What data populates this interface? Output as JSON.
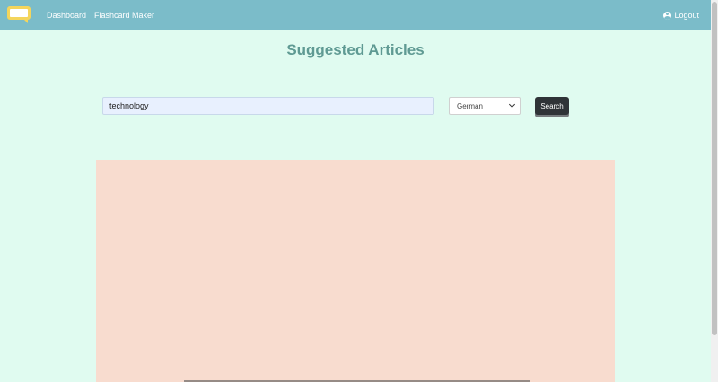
{
  "navbar": {
    "logo_icon": "speech-bubble-logo-icon",
    "links": [
      {
        "label": "Dashboard"
      },
      {
        "label": "Flashcard Maker"
      }
    ],
    "logout": {
      "label": "Logout",
      "icon": "user-circle-icon"
    },
    "bg_color": "#7bbcc9"
  },
  "page": {
    "title": "Suggested Articles",
    "bg_color": "#e0fbf0",
    "title_color": "#5f9a93"
  },
  "search": {
    "value": "technology",
    "placeholder": "",
    "language_selected": "German",
    "language_icon": "chevron-down-icon",
    "button_label": "Search"
  },
  "articles": {
    "panel_color": "#f8dccf"
  }
}
